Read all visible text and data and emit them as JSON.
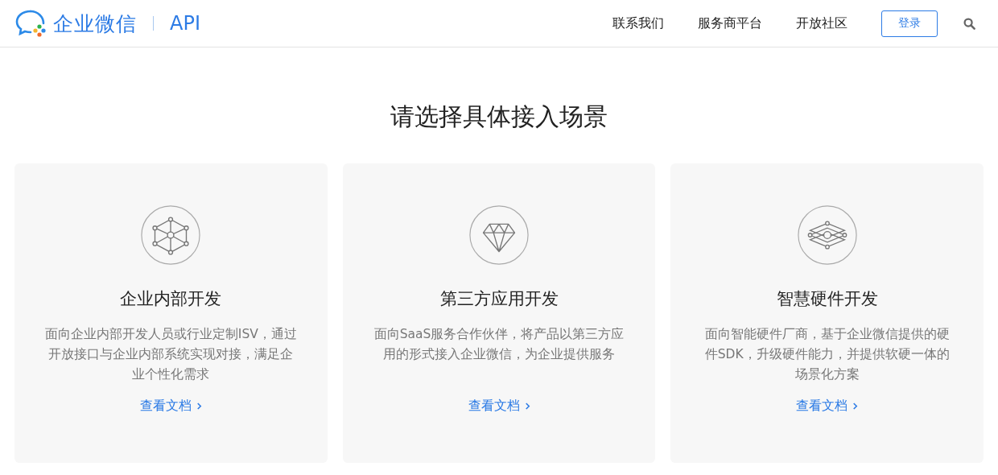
{
  "header": {
    "brand": "企业微信",
    "product": "API",
    "nav": [
      "联系我们",
      "服务商平台",
      "开放社区"
    ],
    "login": "登录"
  },
  "heading": "请选择具体接入场景",
  "cards": [
    {
      "kind": "cube",
      "title": "企业内部开发",
      "description": "面向企业内部开发人员或行业定制ISV，通过开放接口与企业内部系统实现对接，满足企业个性化需求",
      "link": "查看文档"
    },
    {
      "kind": "diamond",
      "title": "第三方应用开发",
      "description": "面向SaaS服务合作伙伴，将产品以第三方应用的形式接入企业微信，为企业提供服务",
      "link": "查看文档"
    },
    {
      "kind": "layers",
      "title": "智慧硬件开发",
      "description": "面向智能硬件厂商，基于企业微信提供的硬件SDK，升级硬件能力，并提供软硬一体的场景化方案",
      "link": "查看文档"
    }
  ]
}
